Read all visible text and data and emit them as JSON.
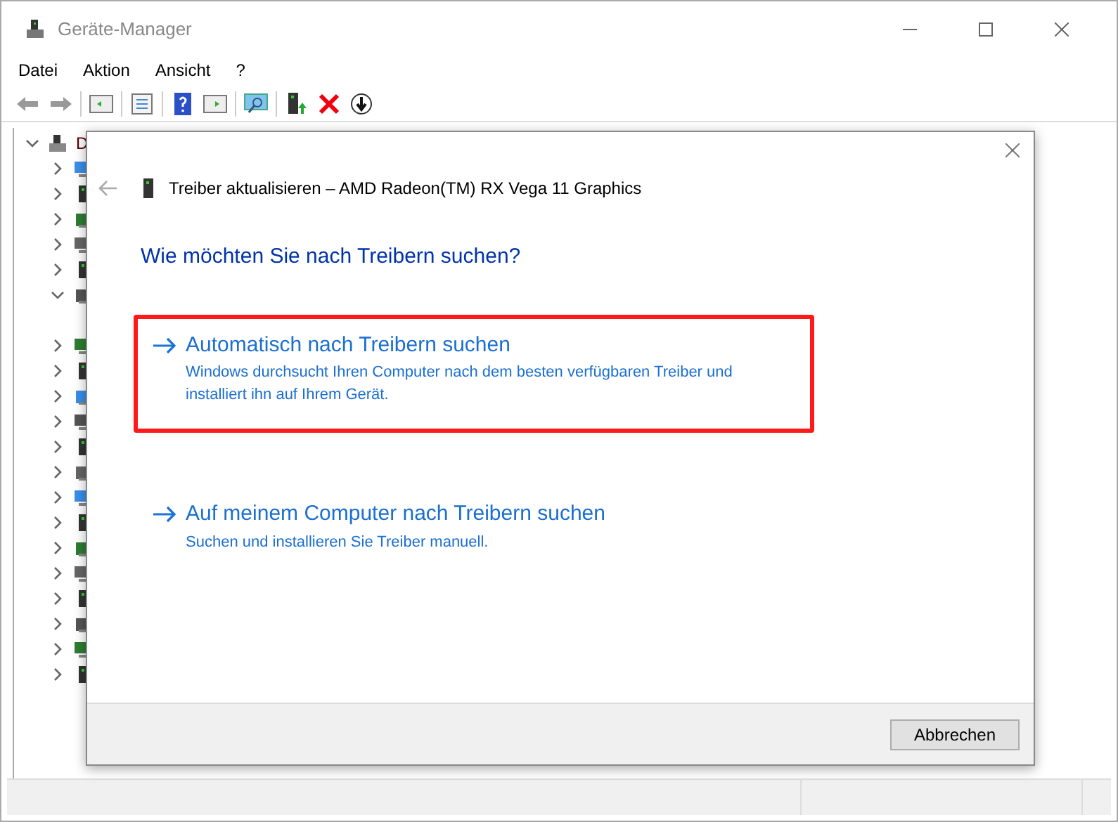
{
  "window": {
    "title": "Geräte-Manager"
  },
  "menu": [
    "Datei",
    "Aktion",
    "Ansicht",
    "?"
  ],
  "tree": {
    "label": "D",
    "expanded": true,
    "children": [
      {
        "kind": "group",
        "expanded": false
      },
      {
        "kind": "group",
        "expanded": false
      },
      {
        "kind": "group",
        "expanded": false
      },
      {
        "kind": "group",
        "expanded": false
      },
      {
        "kind": "group",
        "expanded": false
      },
      {
        "kind": "group",
        "expanded": true
      },
      {
        "kind": "group",
        "expanded": false
      },
      {
        "kind": "group",
        "expanded": false
      },
      {
        "kind": "group",
        "expanded": false
      },
      {
        "kind": "group",
        "expanded": false
      },
      {
        "kind": "group",
        "expanded": false
      },
      {
        "kind": "group",
        "expanded": false
      },
      {
        "kind": "group",
        "expanded": false
      },
      {
        "kind": "group",
        "expanded": false
      },
      {
        "kind": "group",
        "expanded": false
      },
      {
        "kind": "group",
        "expanded": false
      },
      {
        "kind": "group",
        "expanded": false
      },
      {
        "kind": "group",
        "expanded": false
      },
      {
        "kind": "group",
        "expanded": false
      },
      {
        "kind": "group",
        "expanded": false
      }
    ]
  },
  "dialog": {
    "title": "Treiber aktualisieren – AMD Radeon(TM) RX Vega 11 Graphics",
    "heading": "Wie möchten Sie nach Treibern suchen?",
    "options": [
      {
        "title": "Automatisch nach Treibern suchen",
        "description": "Windows durchsucht Ihren Computer nach dem besten verfügbaren Treiber und installiert ihn auf Ihrem Gerät.",
        "selected": true
      },
      {
        "title": "Auf meinem Computer nach Treibern suchen",
        "description": "Suchen und installieren Sie Treiber manuell.",
        "selected": false
      }
    ],
    "cancel": "Abbrechen"
  }
}
